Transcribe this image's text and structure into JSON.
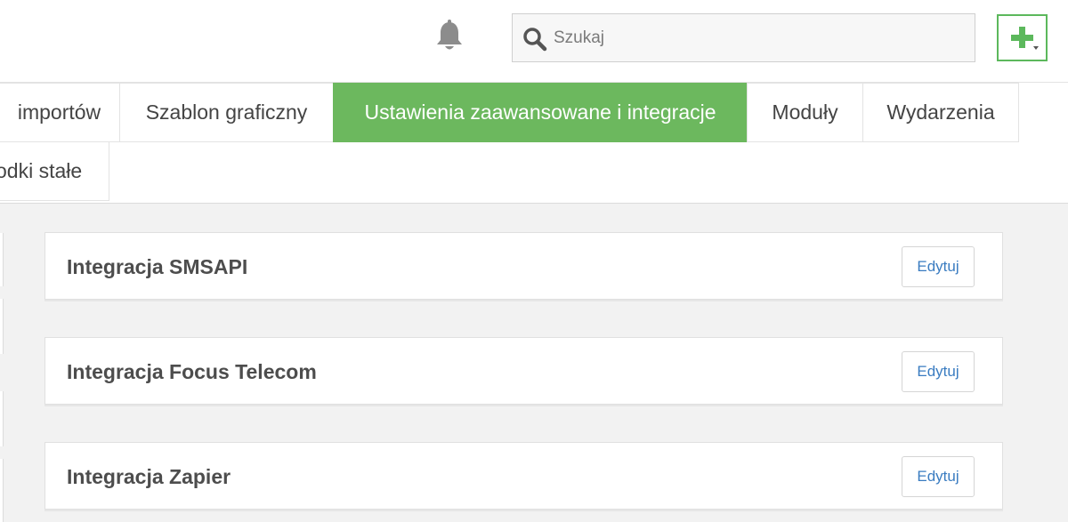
{
  "header": {
    "search_placeholder": "Szukaj"
  },
  "colors": {
    "accent": "#6cb85e",
    "link": "#3a7cc1"
  },
  "icons": {
    "notifications": "bell-icon",
    "search": "search-icon",
    "add": "plus-icon"
  },
  "tabs": [
    {
      "label": "importów",
      "active": false
    },
    {
      "label": "Szablon graficzny",
      "active": false
    },
    {
      "label": "Ustawienia zaawansowane i integracje",
      "active": true
    },
    {
      "label": "Moduły",
      "active": false
    },
    {
      "label": "Wydarzenia",
      "active": false
    },
    {
      "label": "odki stałe",
      "active": false
    }
  ],
  "integrations": [
    {
      "title": "Integracja SMSAPI",
      "edit_label": "Edytuj"
    },
    {
      "title": "Integracja Focus Telecom",
      "edit_label": "Edytuj"
    },
    {
      "title": "Integracja Zapier",
      "edit_label": "Edytuj"
    }
  ]
}
